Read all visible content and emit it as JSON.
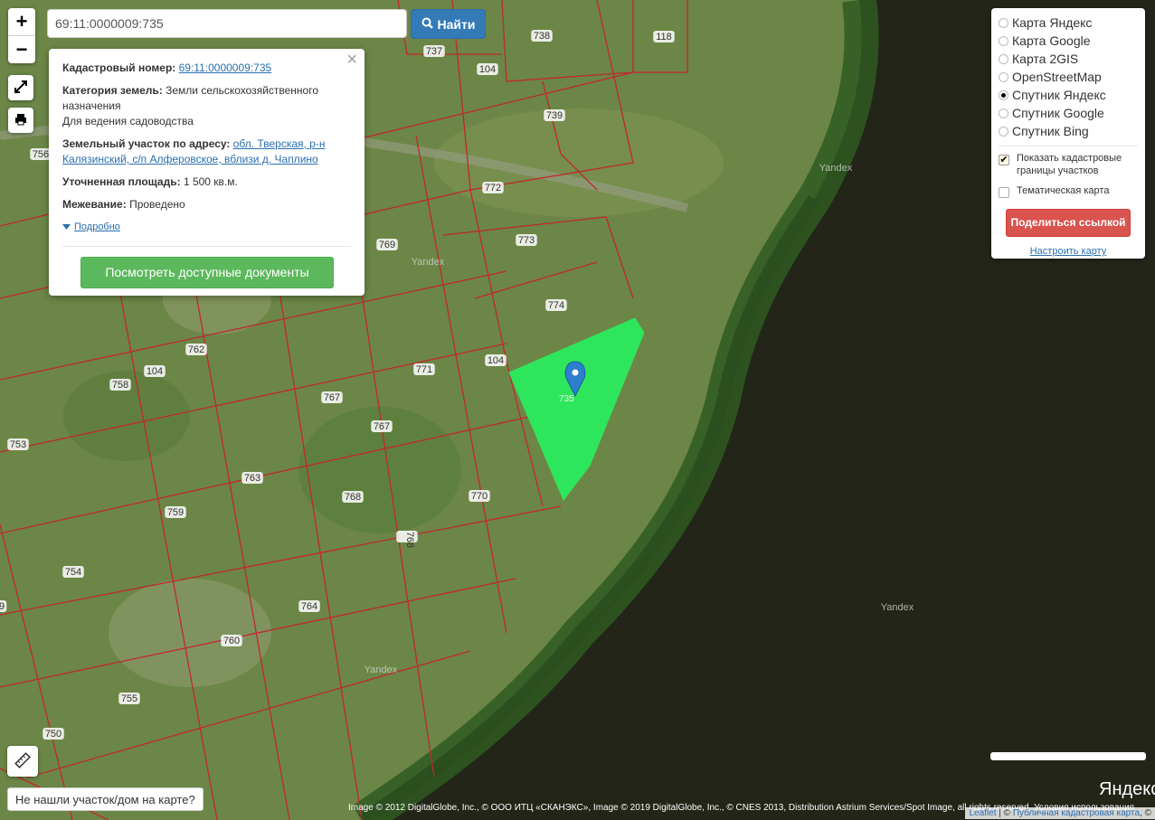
{
  "search": {
    "value": "69:11:0000009:735",
    "button_label": "Найти"
  },
  "zoom": {
    "in": "+",
    "out": "−"
  },
  "popup": {
    "cad_label": "Кадастровый номер:",
    "cad_value": "69:11:0000009:735",
    "category_label": "Категория земель:",
    "category_value": "Земли сельскохозяйственного назначения",
    "usage": "Для ведения садоводства",
    "address_label": "Земельный участок по адресу:",
    "address_value": "обл. Тверская, р-н Калязинский, с/п Алферовское, вблизи д. Чаплино",
    "area_label": "Уточненная площадь:",
    "area_value": "1 500 кв.м.",
    "survey_label": "Межевание:",
    "survey_value": "Проведено",
    "more_label": "Подробно",
    "docs_button": "Посмотреть доступные документы"
  },
  "layers": {
    "options": [
      {
        "label": "Карта Яндекс",
        "selected": false
      },
      {
        "label": "Карта Google",
        "selected": false
      },
      {
        "label": "Карта 2GIS",
        "selected": false
      },
      {
        "label": "OpenStreetMap",
        "selected": false
      },
      {
        "label": "Спутник Яндекс",
        "selected": true
      },
      {
        "label": "Спутник Google",
        "selected": false
      },
      {
        "label": "Спутник Bing",
        "selected": false
      }
    ],
    "show_borders_label": "Показать кадастровые границы участков",
    "show_borders_checked": true,
    "thematic_label": "Тематическая карта",
    "thematic_checked": false,
    "share_button": "Поделиться ссылкой",
    "configure_link": "Настроить карту"
  },
  "map": {
    "selected_parcel": "735",
    "parcel_labels": [
      "738",
      "118",
      "737",
      "104",
      "739",
      "756",
      "772",
      "773",
      "769",
      "774",
      "762",
      "104",
      "771",
      "104",
      "758",
      "767",
      "753",
      "767",
      "763",
      "770",
      "759",
      "768",
      "768",
      "754",
      "764",
      "9",
      "760",
      "755",
      "750"
    ],
    "watermarks": [
      "Yandex",
      "Yandex",
      "Yandex",
      "Yandex"
    ],
    "colors": {
      "parcel_border": "#c0282e",
      "selected_fill": "#2ee65c",
      "water": "#1f2218"
    }
  },
  "bottom": {
    "not_found": "Не нашли участок/дом на карте?",
    "yandex_logo": "Яндекс",
    "copyright": "Image © 2012 DigitalGlobe, Inc., © ООО ИТЦ «СКАНЭКС», Image © 2019 DigitalGlobe, Inc., © CNES 2013, Distribution Astrium Services/Spot Image, all rights reserved. Условия использования",
    "attrib_leaflet": "Leaflet",
    "attrib_sep": " | © ",
    "attrib_pkk": "Публичная кадастровая карта",
    "attrib_tail": ", ©"
  }
}
